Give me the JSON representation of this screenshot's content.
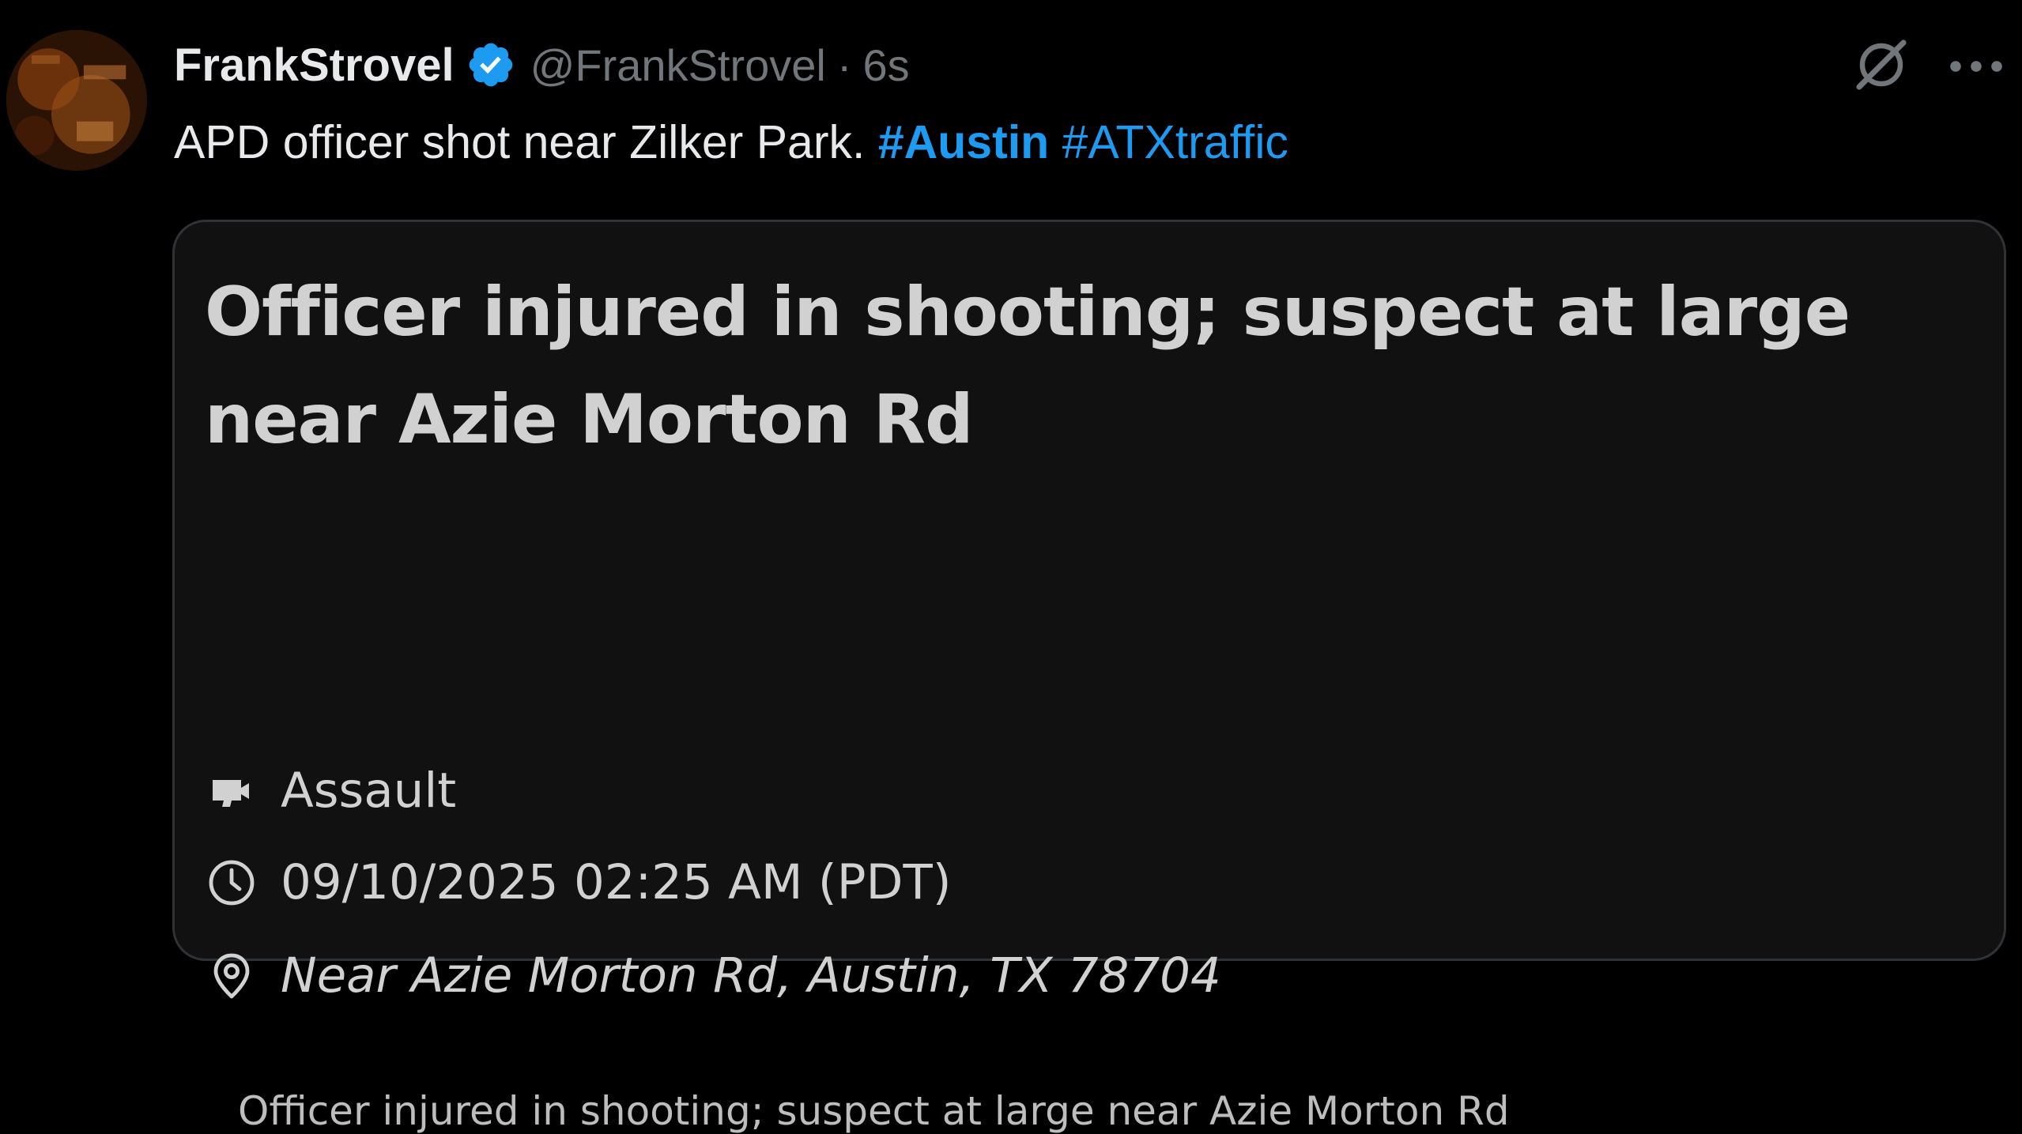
{
  "tweet": {
    "author_name": "FrankStrovel",
    "handle": "@FrankStrovel",
    "separator": "·",
    "timestamp": "6s",
    "text_prefix": "APD officer shot near Zilker Park.",
    "hashtags": [
      "#Austin",
      "#ATXtraffic"
    ],
    "verified_icon": "verified-badge-icon",
    "avatar_icon": "avatar",
    "grok_icon": "grok-icon",
    "more_icon": "more-options-icon"
  },
  "card": {
    "title": "Officer injured in shooting; suspect at large near Azie Morton Rd",
    "category": "Assault",
    "category_icon": "incident-category-icon",
    "datetime": "09/10/2025 02:25 AM (PDT)",
    "datetime_icon": "clock-icon",
    "location": "Near Azie Morton Rd, Austin, TX 78704",
    "location_icon": "map-pin-icon",
    "summary": "Officer injured in shooting; suspect at large near Azie Morton Rd"
  },
  "colors": {
    "background": "#000000",
    "primary_text": "#e7e9ea",
    "secondary_text": "#71767b",
    "hashtag": "#1d9bf0",
    "card_background": "#111111",
    "card_border": "#2f3336",
    "verified_badge": "#1d9bf0"
  }
}
